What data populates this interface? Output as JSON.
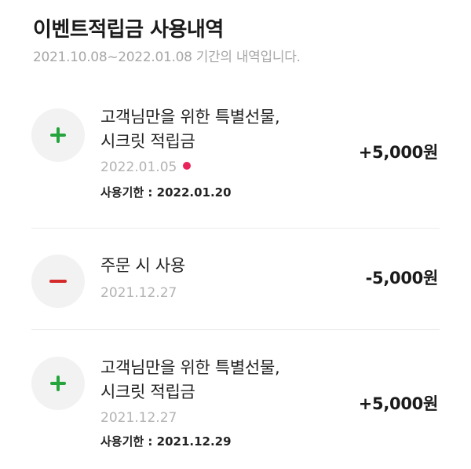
{
  "header": {
    "title": "이벤트적립금 사용내역",
    "period": "2021.10.08~2022.01.08 기간의 내역입니다."
  },
  "entries": [
    {
      "type": "plus",
      "desc_line1": "고객님만을 위한 특별선물,",
      "desc_line2": "시크릿 적립금",
      "date": "2022.01.05",
      "new_dot": true,
      "expiry_label": "사용기한 : ",
      "expiry_date": "2022.01.20",
      "amount": "+5,000원"
    },
    {
      "type": "minus",
      "desc_line1": "주문 시 사용",
      "date": "2021.12.27",
      "amount": "-5,000원"
    },
    {
      "type": "plus",
      "desc_line1": "고객님만을 위한 특별선물,",
      "desc_line2": "시크릿 적립금",
      "date": "2021.12.27",
      "expiry_label": "사용기한 : ",
      "expiry_date": "2021.12.29",
      "amount": "+5,000원"
    }
  ],
  "colors": {
    "plus_icon": "#26a43c",
    "minus_icon": "#d42a2a",
    "new_dot": "#e8245b",
    "muted_text": "#b3b3b3"
  },
  "icons": {
    "plus": "plus-icon",
    "minus": "minus-icon"
  }
}
